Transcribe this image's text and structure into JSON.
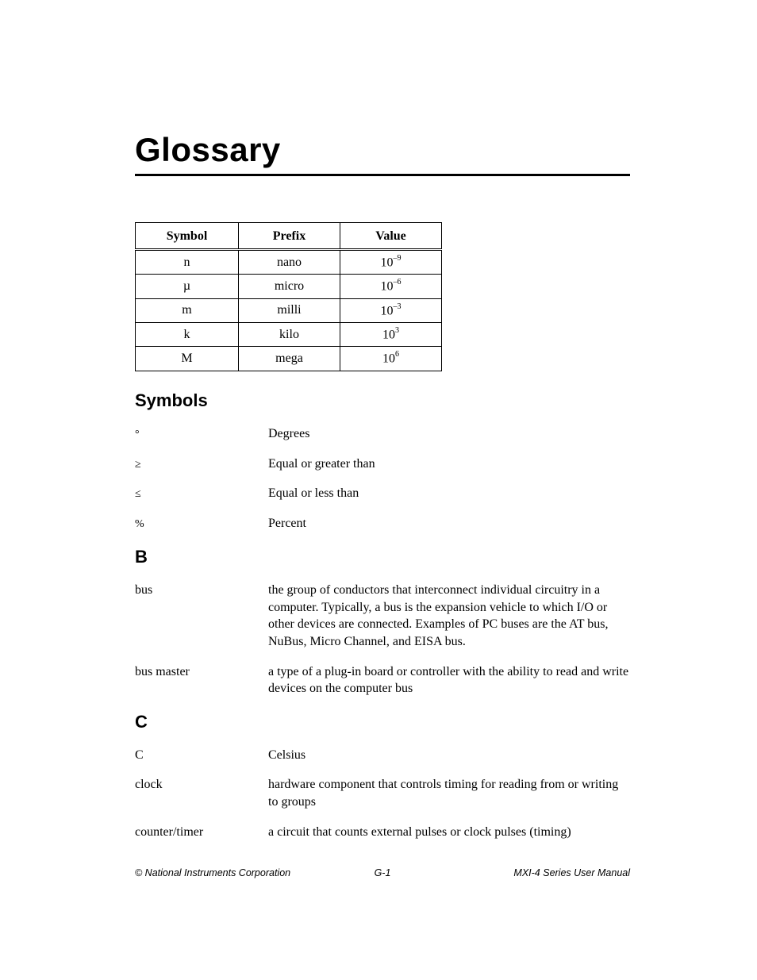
{
  "title": "Glossary",
  "prefix_table": {
    "headers": {
      "symbol": "Symbol",
      "prefix": "Prefix",
      "value": "Value"
    },
    "rows": [
      {
        "symbol": "n",
        "prefix": "nano",
        "value_base": "10",
        "value_exp": "–9"
      },
      {
        "symbol": "µ",
        "prefix": "micro",
        "value_base": "10",
        "value_exp": "–6"
      },
      {
        "symbol": "m",
        "prefix": "milli",
        "value_base": "10",
        "value_exp": "–3"
      },
      {
        "symbol": "k",
        "prefix": "kilo",
        "value_base": "10",
        "value_exp": "3"
      },
      {
        "symbol": "M",
        "prefix": "mega",
        "value_base": "10",
        "value_exp": "6"
      }
    ]
  },
  "sections": {
    "symbols": {
      "heading": "Symbols",
      "items": [
        {
          "term": "°",
          "desc": "Degrees"
        },
        {
          "term": "≥",
          "desc": "Equal or greater than"
        },
        {
          "term": "≤",
          "desc": "Equal or less than"
        },
        {
          "term": "%",
          "desc": "Percent"
        }
      ]
    },
    "b": {
      "heading": "B",
      "items": [
        {
          "term": "bus",
          "desc": "the group of conductors that interconnect individual circuitry in a computer. Typically, a bus is the expansion vehicle to which I/O or other devices are connected. Examples of PC buses are the AT bus, NuBus, Micro Channel, and EISA bus."
        },
        {
          "term": "bus master",
          "desc": "a type of a plug-in board or controller with the ability to read and write devices on the computer bus"
        }
      ]
    },
    "c": {
      "heading": "C",
      "items": [
        {
          "term": "C",
          "desc": "Celsius"
        },
        {
          "term": "clock",
          "desc": "hardware component that controls timing for reading from or writing to groups"
        },
        {
          "term": "counter/timer",
          "desc": "a circuit that counts external pulses or clock pulses (timing)"
        }
      ]
    }
  },
  "footer": {
    "left": "© National Instruments Corporation",
    "center": "G-1",
    "right": "MXI-4 Series User Manual"
  }
}
